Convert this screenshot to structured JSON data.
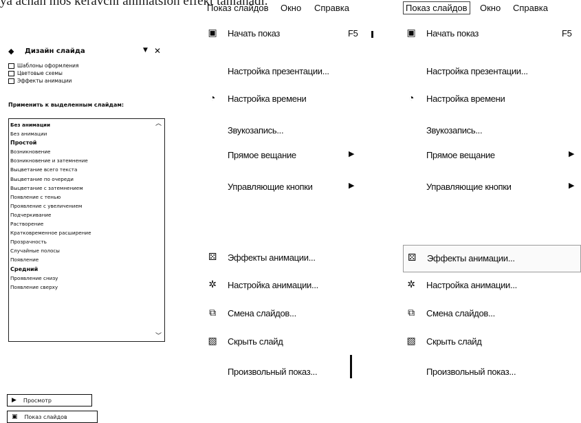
{
  "top_text": "ya achan mos keravchi animatsion effekt tanlanadi.",
  "pane": {
    "title": "Дизайн слайда",
    "links": [
      "Шаблоны оформления",
      "Цветовые схемы",
      "Эффекты анимации"
    ],
    "apply_label": "Применить к выделенным слайдам:",
    "effects": [
      {
        "label": "Без анимации",
        "kind": "sel"
      },
      {
        "label": "Без анимации",
        "kind": ""
      },
      {
        "label": "Простой",
        "kind": "hdr"
      },
      {
        "label": "Возникновение",
        "kind": ""
      },
      {
        "label": "Возникновение и затемнение",
        "kind": ""
      },
      {
        "label": "Выцветание всего текста",
        "kind": ""
      },
      {
        "label": "Выцветание по очереди",
        "kind": ""
      },
      {
        "label": "Выцветание с затемнением",
        "kind": ""
      },
      {
        "label": "Появление с тенью",
        "kind": ""
      },
      {
        "label": "Проявление с увеличением",
        "kind": ""
      },
      {
        "label": "Подчеркивание",
        "kind": ""
      },
      {
        "label": "Растворение",
        "kind": ""
      },
      {
        "label": "Кратковременное расширение",
        "kind": ""
      },
      {
        "label": "Прозрачность",
        "kind": ""
      },
      {
        "label": "Случайные полосы",
        "kind": ""
      },
      {
        "label": "Появление",
        "kind": ""
      },
      {
        "label": "Средний",
        "kind": "hdr"
      },
      {
        "label": "Проявление снизу",
        "kind": ""
      },
      {
        "label": "Появление сверху",
        "kind": ""
      }
    ],
    "preview_button": "Просмотр",
    "slideshow_button": "Показ слайдов"
  },
  "menubar": {
    "slideshow": "Показ слайдов",
    "window": "Окно",
    "help": "Справка"
  },
  "menu_items": [
    {
      "label": "Начать показ",
      "shortcut": "F5",
      "icon": "slideshow-icon",
      "submenu": false
    },
    {
      "label": "Настройка презентации...",
      "shortcut": "",
      "icon": "",
      "submenu": false
    },
    {
      "label": "Настройка времени",
      "shortcut": "",
      "icon": "timer-icon",
      "submenu": false
    },
    {
      "label": "Звукозапись...",
      "shortcut": "",
      "icon": "",
      "submenu": false
    },
    {
      "label": "Прямое вещание",
      "shortcut": "",
      "icon": "",
      "submenu": true
    },
    {
      "label": "Управляющие кнопки",
      "shortcut": "",
      "icon": "",
      "submenu": true
    },
    {
      "label": "",
      "shortcut": "",
      "icon": "",
      "submenu": false
    },
    {
      "label": "Эффекты анимации...",
      "shortcut": "",
      "icon": "animation-effects-icon",
      "submenu": false
    },
    {
      "label": "Настройка анимации...",
      "shortcut": "",
      "icon": "custom-animation-icon",
      "submenu": false
    },
    {
      "label": "Смена слайдов...",
      "shortcut": "",
      "icon": "slide-transition-icon",
      "submenu": false
    },
    {
      "label": "Скрыть слайд",
      "shortcut": "",
      "icon": "hide-slide-icon",
      "submenu": false
    },
    {
      "label": "Произвольный показ...",
      "shortcut": "",
      "icon": "",
      "submenu": false
    }
  ],
  "highlighted_item_right_menu": "Эффекты анимации..."
}
